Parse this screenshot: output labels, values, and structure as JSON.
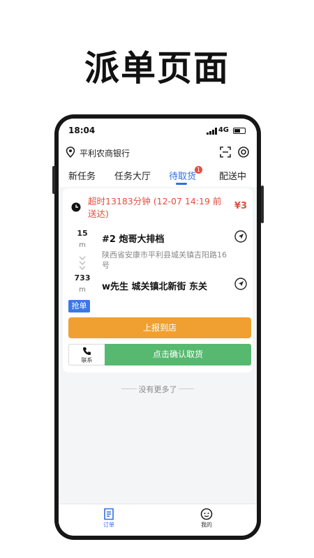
{
  "headline": "派单页面",
  "status_bar": {
    "time": "18:04",
    "network": "4G"
  },
  "header": {
    "location_name": "平利农商银行"
  },
  "tabs": [
    {
      "label": "新任务",
      "active": false
    },
    {
      "label": "任务大厅",
      "active": false
    },
    {
      "label": "待取货",
      "active": true,
      "badge": "1"
    },
    {
      "label": "配送中",
      "active": false
    }
  ],
  "order": {
    "timeout_text": "超时13183分钟 (12-07 14:19 前送达)",
    "price": "¥3",
    "pickup_distance": "15",
    "pickup_unit": "m",
    "shop_name": "#2 炮哥大排档",
    "shop_address": "陕西省安康市平利县城关镇吉阳路16号",
    "delivery_distance": "733",
    "delivery_unit": "m",
    "customer": "w先生 城关镇北新街 东关",
    "grab_label": "抢单",
    "report_button": "上报到店",
    "contact_label": "联系",
    "confirm_button": "点击确认取货"
  },
  "no_more_text": "没有更多了",
  "bottom_nav": [
    {
      "label": "订单",
      "active": true
    },
    {
      "label": "我的",
      "active": false
    }
  ],
  "colors": {
    "accent_blue": "#2f6fe4",
    "alert_red": "#e74c3c",
    "report_orange": "#f0a030",
    "confirm_green": "#57b96f"
  }
}
